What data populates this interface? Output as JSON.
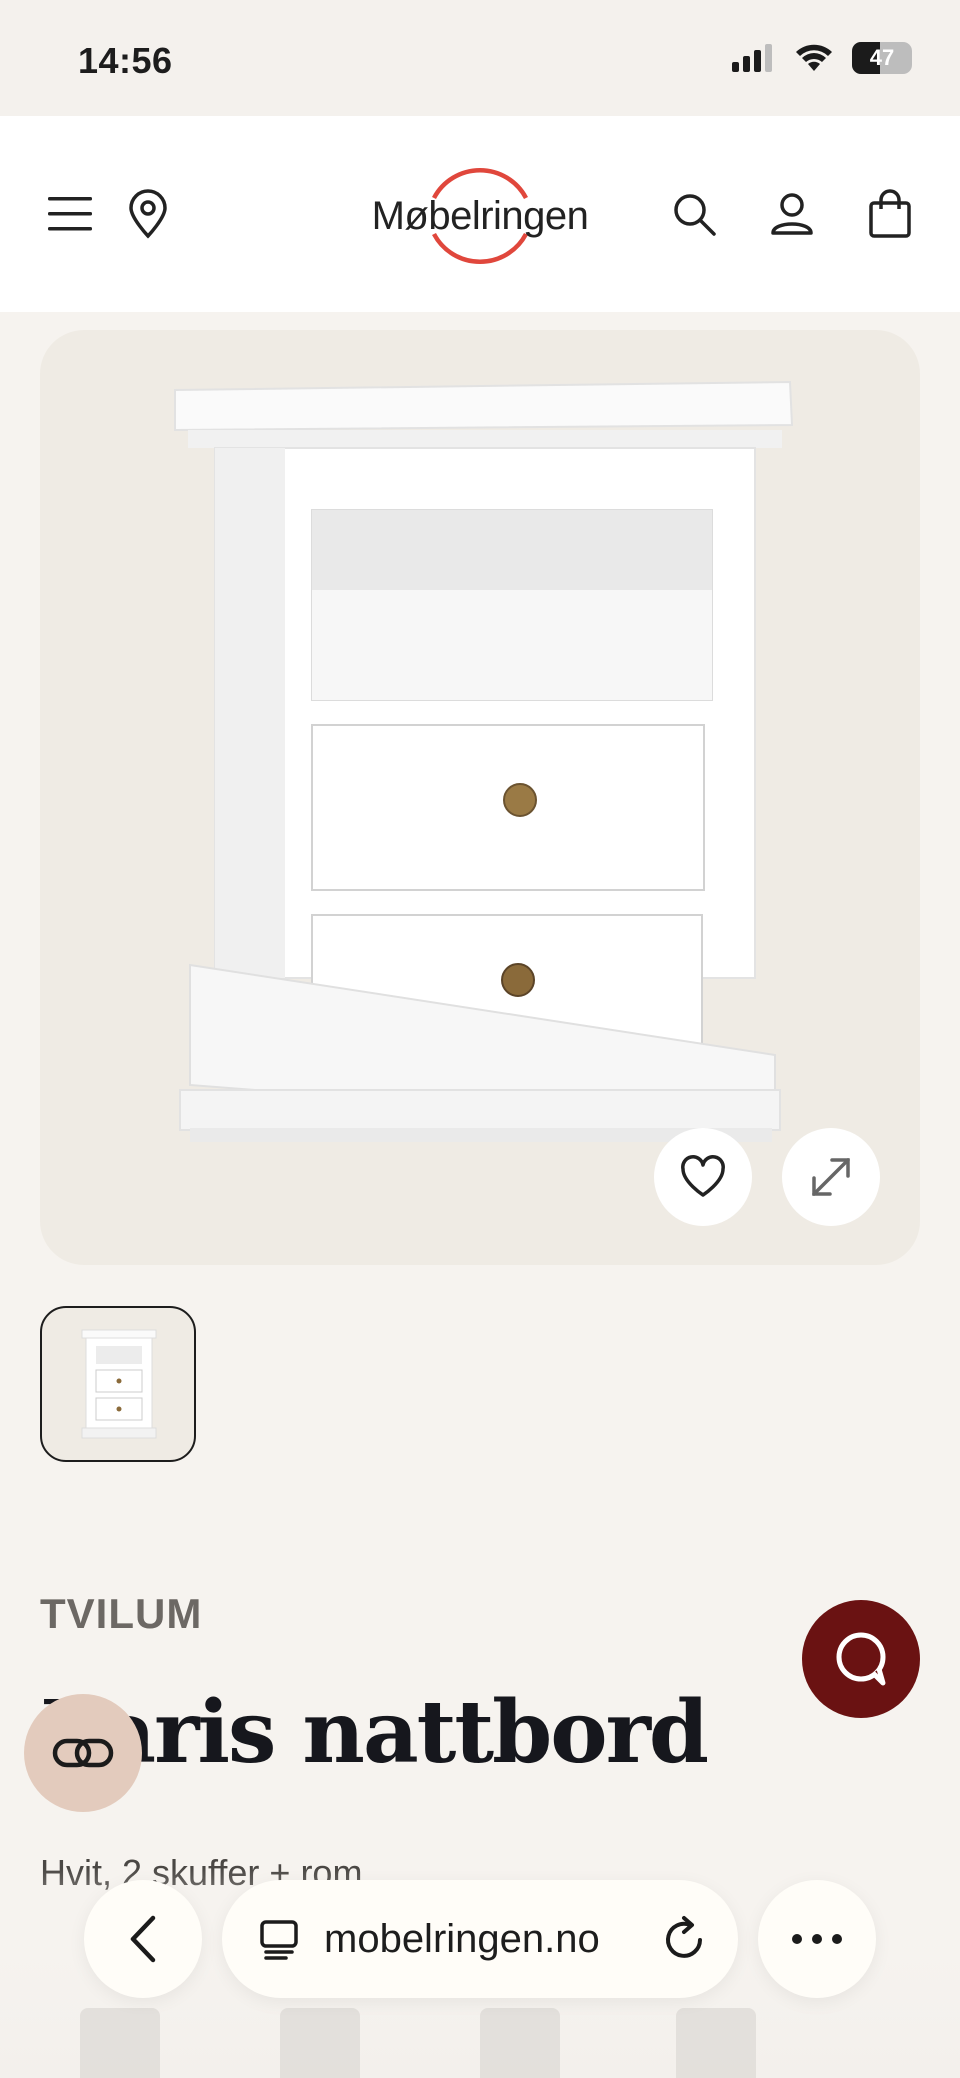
{
  "status": {
    "time": "14:56",
    "battery": "47",
    "signal_icon": "cellular-signal-icon",
    "wifi_icon": "wifi-icon"
  },
  "header": {
    "logo_text": "Møbelringen",
    "menu_icon": "hamburger-menu-icon",
    "location_icon": "map-pin-icon",
    "search_icon": "search-icon",
    "account_icon": "user-icon",
    "cart_icon": "shopping-bag-icon",
    "brand_accent": "#e0473c"
  },
  "product": {
    "brand": "TVILUM",
    "title": "Paris nattbord",
    "subtitle": "Hvit, 2 skuffer + rom",
    "image_alt": "White bedside table with open shelf and two drawers",
    "favorite_icon": "heart-icon",
    "expand_icon": "expand-arrows-icon"
  },
  "fabs": {
    "chat_color": "#6a1212",
    "chat_icon": "chat-bubble-icon",
    "link_icon": "link-icon"
  },
  "browser": {
    "url": "mobelringen.no",
    "back_icon": "chevron-left-icon",
    "tabs_icon": "reader-icon",
    "reload_icon": "reload-icon",
    "more_icon": "more-dots-icon"
  }
}
